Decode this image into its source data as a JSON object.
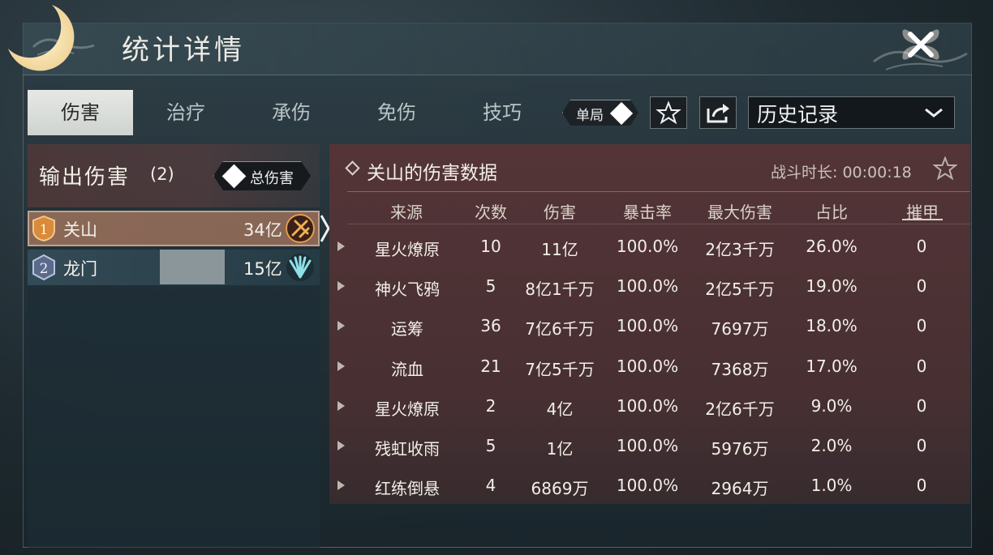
{
  "window": {
    "title": "统计详情"
  },
  "tabs": [
    {
      "label": "伤害",
      "active": true
    },
    {
      "label": "治疗",
      "active": false
    },
    {
      "label": "承伤",
      "active": false
    },
    {
      "label": "免伤",
      "active": false
    },
    {
      "label": "技巧",
      "active": false
    }
  ],
  "toolbar": {
    "mode_label": "单局",
    "history_select": "历史记录"
  },
  "left_panel": {
    "title": "输出伤害",
    "count": "(2)",
    "total_button": "总伤害",
    "players": [
      {
        "rank": "1",
        "name": "关山",
        "value": "34亿",
        "selected": true
      },
      {
        "rank": "2",
        "name": "龙门",
        "value": "15亿",
        "selected": false
      }
    ]
  },
  "right_panel": {
    "title": "关山的伤害数据",
    "duration": "战斗时长: 00:00:18",
    "columns": [
      "来源",
      "次数",
      "伤害",
      "暴击率",
      "最大伤害",
      "占比",
      "摧甲"
    ],
    "rows": [
      [
        "星火燎原",
        "10",
        "11亿",
        "100.0%",
        "2亿3千万",
        "26.0%",
        "0"
      ],
      [
        "神火飞鸦",
        "5",
        "8亿1千万",
        "100.0%",
        "2亿5千万",
        "19.0%",
        "0"
      ],
      [
        "运筹",
        "36",
        "7亿6千万",
        "100.0%",
        "7697万",
        "18.0%",
        "0"
      ],
      [
        "流血",
        "21",
        "7亿5千万",
        "100.0%",
        "7368万",
        "17.0%",
        "0"
      ],
      [
        "星火燎原",
        "2",
        "4亿",
        "100.0%",
        "2亿6千万",
        "9.0%",
        "0"
      ],
      [
        "残虹收雨",
        "5",
        "1亿",
        "100.0%",
        "5976万",
        "2.0%",
        "0"
      ],
      [
        "红练倒悬",
        "4",
        "6869万",
        "100.0%",
        "2964万",
        "1.0%",
        "0"
      ]
    ]
  },
  "icons": {
    "close": "close-icon",
    "star": "star-icon",
    "share": "share-icon",
    "dropdown": "chevron-down-icon"
  },
  "colors": {
    "selected_row": "#a87860",
    "right_panel_bg": "#5a3436",
    "tab_active_bg": "#e6e8e6"
  }
}
